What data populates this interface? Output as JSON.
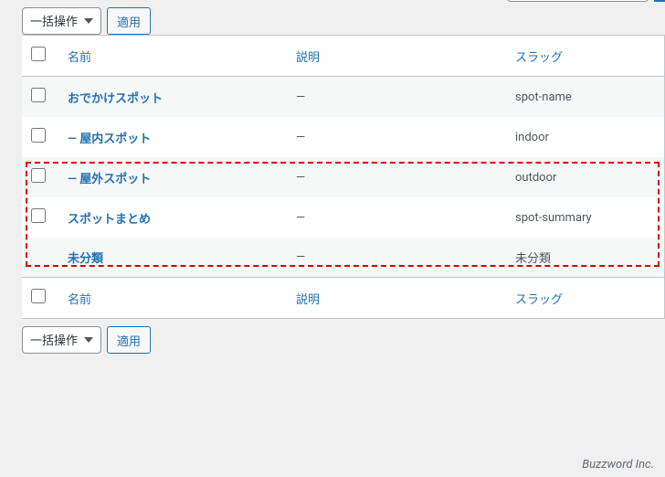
{
  "actions": {
    "bulk_label": "一括操作",
    "apply_label": "適用"
  },
  "search": {
    "value": ""
  },
  "columns": {
    "name": "名前",
    "description": "説明",
    "slug": "スラッグ"
  },
  "rows": [
    {
      "name": "おでかけスポット",
      "description": "—",
      "slug": "spot-name",
      "has_checkbox": true,
      "indent": ""
    },
    {
      "name": "— 屋内スポット",
      "description": "—",
      "slug": "indoor",
      "has_checkbox": true,
      "indent": ""
    },
    {
      "name": "— 屋外スポット",
      "description": "—",
      "slug": "outdoor",
      "has_checkbox": true,
      "indent": ""
    },
    {
      "name": "スポットまとめ",
      "description": "—",
      "slug": "spot-summary",
      "has_checkbox": true,
      "indent": ""
    },
    {
      "name": "未分類",
      "description": "—",
      "slug": "未分類",
      "has_checkbox": false,
      "indent": ""
    }
  ],
  "footer": {
    "credit": "Buzzword Inc."
  }
}
